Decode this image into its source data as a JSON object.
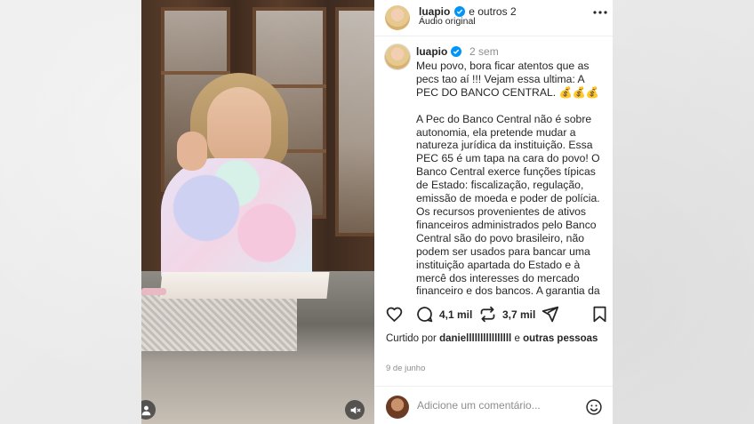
{
  "post": {
    "header": {
      "username": "luapio",
      "coauthors": "e outros 2",
      "audio": "Áudio original",
      "more_icon": "more-horizontal-icon"
    },
    "caption": {
      "username": "luapio",
      "time": "2 sem",
      "text": "Meu povo, bora ficar atentos que as pecs tao aí !!! Vejam essa ultima: A PEC DO BANCO CENTRAL. 💰💰💰\n\nA Pec do Banco Central não é sobre autonomia, ela pretende mudar a natureza jurídica da instituição. Essa PEC 65 é um tapa na cara do povo! O Banco Central exerce funções típicas de Estado: fiscalização, regulação, emissão de moeda e poder de polícia. Os recursos provenientes de ativos financeiros administrados pelo Banco Central são do povo brasileiro, não podem ser usados para bancar uma instituição apartada do Estado e à mercê dos interesses do mercado financeiro e dos bancos. A garantia da"
    },
    "actions": {
      "comments_count": "4,1 mil",
      "reposts_count": "3,7 mil"
    },
    "likes": {
      "prefix": "Curtido por",
      "user": "daniellllllllllllllll",
      "middle": "e",
      "others": "outras pessoas"
    },
    "date": "9 de junho",
    "comment": {
      "placeholder": "Adicione um comentário..."
    }
  },
  "colors": {
    "verified": "#0095f6",
    "text": "#262626",
    "muted": "#8e8e8e"
  }
}
